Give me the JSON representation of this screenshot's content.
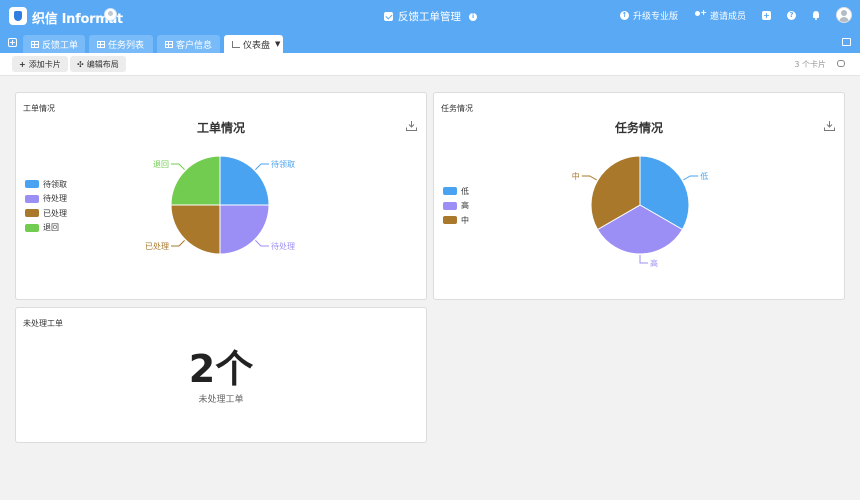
{
  "app": {
    "brand": "织信 Informat",
    "title": "反馈工单管理"
  },
  "header_actions": {
    "upgrade": "升级专业版",
    "invite": "邀请成员"
  },
  "tabs": [
    {
      "label": "反馈工单",
      "active": false
    },
    {
      "label": "任务列表",
      "active": false
    },
    {
      "label": "客户信息",
      "active": false
    },
    {
      "label": "仪表盘",
      "active": true
    }
  ],
  "toolbar": {
    "add_card": "添加卡片",
    "edit_layout": "编辑布局",
    "card_count": "3 个卡片"
  },
  "cards": [
    {
      "label": "工单情况",
      "chart_title": "工单情况",
      "legend": [
        {
          "name": "待领取",
          "color": "#4aa3f0"
        },
        {
          "name": "待处理",
          "color": "#9b8ff5"
        },
        {
          "name": "已处理",
          "color": "#a9782a"
        },
        {
          "name": "退回",
          "color": "#72cc50"
        }
      ]
    },
    {
      "label": "任务情况",
      "chart_title": "任务情况",
      "legend": [
        {
          "name": "低",
          "color": "#4aa3f0"
        },
        {
          "name": "高",
          "color": "#9b8ff5"
        },
        {
          "name": "中",
          "color": "#a9782a"
        }
      ]
    },
    {
      "label": "未处理工单",
      "metric_value": "2个",
      "metric_label": "未处理工单"
    }
  ],
  "chart_data": [
    {
      "type": "pie",
      "title": "工单情况",
      "categories": [
        "待领取",
        "待处理",
        "已处理",
        "退回"
      ],
      "values": [
        1,
        1,
        1,
        1
      ],
      "colors": [
        "#4aa3f0",
        "#9b8ff5",
        "#a9782a",
        "#72cc50"
      ],
      "legend": "left"
    },
    {
      "type": "pie",
      "title": "任务情况",
      "categories": [
        "低",
        "高",
        "中"
      ],
      "values": [
        1,
        1,
        1
      ],
      "colors": [
        "#4aa3f0",
        "#9b8ff5",
        "#a9782a"
      ],
      "legend": "left"
    }
  ]
}
